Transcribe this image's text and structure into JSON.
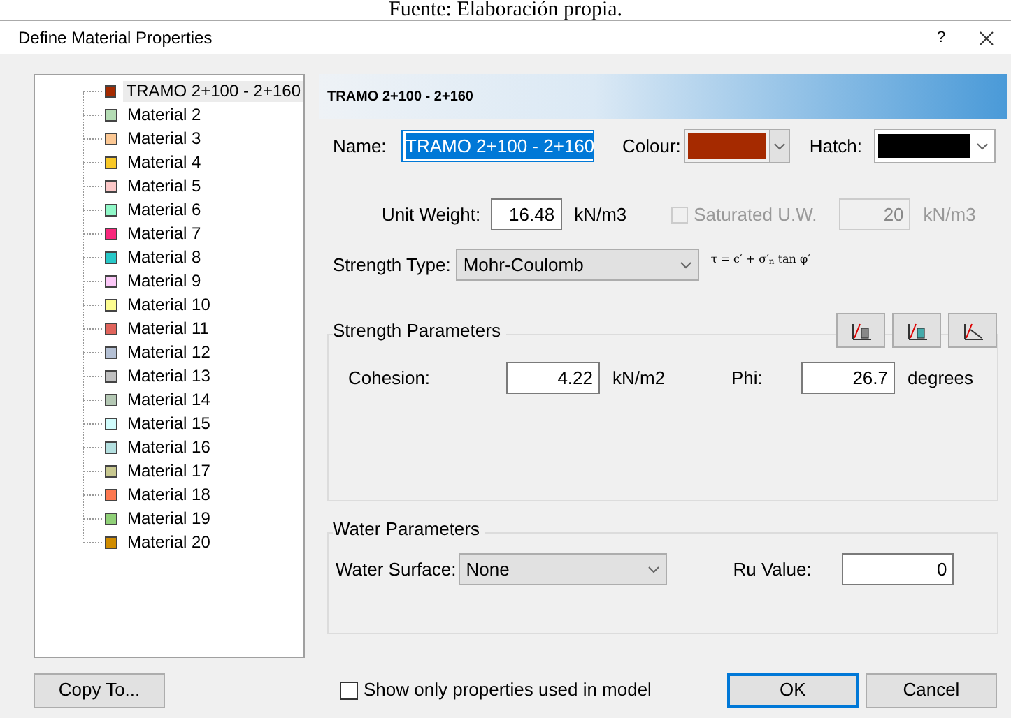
{
  "caption": "Fuente: Elaboración propia.",
  "window": {
    "title": "Define Material Properties",
    "help": "?"
  },
  "materials": [
    {
      "label": "TRAMO 2+100 - 2+160",
      "color": "#a52a00",
      "selected": true
    },
    {
      "label": "Material 2",
      "color": "#b4dcb4",
      "selected": false
    },
    {
      "label": "Material 3",
      "color": "#fcc894",
      "selected": false
    },
    {
      "label": "Material 4",
      "color": "#f8c828",
      "selected": false
    },
    {
      "label": "Material 5",
      "color": "#fcc8c8",
      "selected": false
    },
    {
      "label": "Material 6",
      "color": "#90f8c8",
      "selected": false
    },
    {
      "label": "Material 7",
      "color": "#f8287c",
      "selected": false
    },
    {
      "label": "Material 8",
      "color": "#28c8c8",
      "selected": false
    },
    {
      "label": "Material 9",
      "color": "#fcc8f8",
      "selected": false
    },
    {
      "label": "Material 10",
      "color": "#fcfc90",
      "selected": false
    },
    {
      "label": "Material 11",
      "color": "#e0645c",
      "selected": false
    },
    {
      "label": "Material 12",
      "color": "#b4c0d4",
      "selected": false
    },
    {
      "label": "Material 13",
      "color": "#c0c0c0",
      "selected": false
    },
    {
      "label": "Material 14",
      "color": "#b4c8b4",
      "selected": false
    },
    {
      "label": "Material 15",
      "color": "#d0fcfc",
      "selected": false
    },
    {
      "label": "Material 16",
      "color": "#b4e0e0",
      "selected": false
    },
    {
      "label": "Material 17",
      "color": "#c8c890",
      "selected": false
    },
    {
      "label": "Material 18",
      "color": "#fc7850",
      "selected": false
    },
    {
      "label": "Material 19",
      "color": "#90d078",
      "selected": false
    },
    {
      "label": "Material 20",
      "color": "#d08c00",
      "selected": false
    }
  ],
  "header": "TRAMO 2+100 - 2+160",
  "name": {
    "label": "Name:",
    "value": "TRAMO 2+100 - 2+160"
  },
  "colour": {
    "label": "Colour:",
    "color": "#a52a00"
  },
  "hatch": {
    "label": "Hatch:",
    "color": "#000000"
  },
  "unit_weight": {
    "label": "Unit Weight:",
    "value": "16.48",
    "unit": "kN/m3"
  },
  "saturated": {
    "label": "Saturated U.W.",
    "checked": false,
    "disabled": true,
    "value": "20",
    "unit": "kN/m3"
  },
  "strength_type": {
    "label": "Strength Type:",
    "value": "Mohr-Coulomb",
    "formula": "τ = c′ + σ′$_{n}$ tan φ′"
  },
  "strength_parameters": {
    "title": "Strength Parameters",
    "cohesion": {
      "label": "Cohesion:",
      "value": "4.22",
      "unit": "kN/m2"
    },
    "phi": {
      "label": "Phi:",
      "value": "26.7",
      "unit": "degrees"
    }
  },
  "water_parameters": {
    "title": "Water Parameters",
    "surface": {
      "label": "Water Surface:",
      "value": "None"
    },
    "ru": {
      "label": "Ru Value:",
      "value": "0"
    }
  },
  "copy_button": "Copy To...",
  "show_only": {
    "label": "Show only properties used in model",
    "checked": false
  },
  "buttons": [
    "OK",
    "Cancel"
  ]
}
